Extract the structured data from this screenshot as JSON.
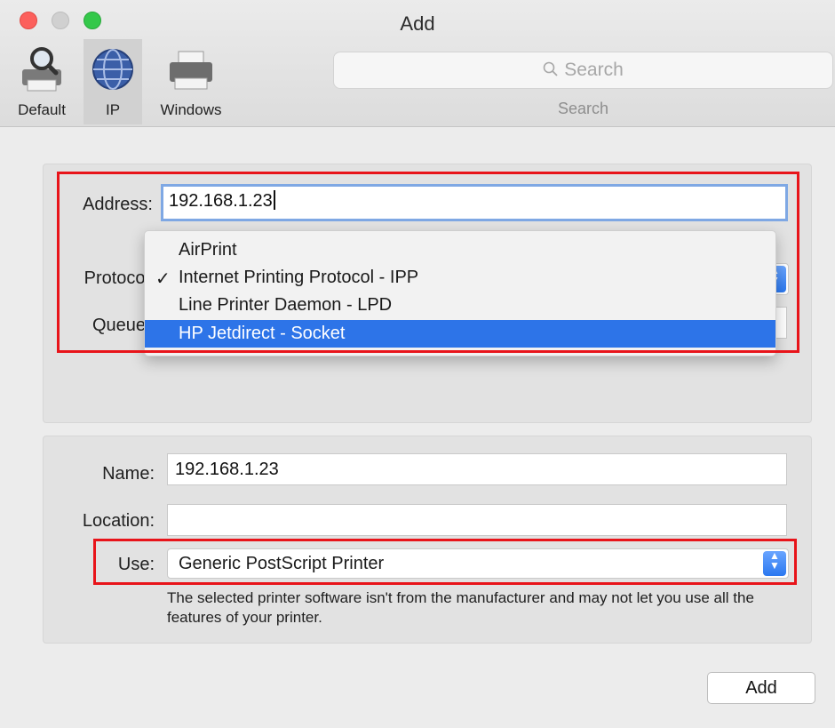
{
  "window": {
    "title": "Add"
  },
  "toolbar": {
    "tabs": [
      {
        "label": "Default",
        "icon": "magnifier-printer-icon"
      },
      {
        "label": "IP",
        "icon": "globe-icon",
        "active": true
      },
      {
        "label": "Windows",
        "icon": "printer-icon"
      }
    ],
    "search": {
      "placeholder": "Search",
      "caption": "Search"
    }
  },
  "form": {
    "address": {
      "label": "Address:",
      "value": "192.168.1.23"
    },
    "protocol": {
      "label": "Protocol"
    },
    "queue": {
      "label": "Queue"
    },
    "protocol_menu": {
      "items": [
        {
          "label": "AirPrint"
        },
        {
          "label": "Internet Printing Protocol - IPP",
          "checked": true,
          "check_glyph": "✓"
        },
        {
          "label": "Line Printer Daemon - LPD"
        },
        {
          "label": "HP Jetdirect - Socket",
          "highlighted": true
        }
      ]
    },
    "name": {
      "label": "Name:",
      "value": "192.168.1.23"
    },
    "location": {
      "label": "Location:",
      "value": ""
    },
    "use": {
      "label": "Use:",
      "value": "Generic PostScript Printer"
    },
    "note": "The selected printer software isn't from the manufacturer and may not let you use all the features of your printer."
  },
  "buttons": {
    "add": "Add"
  },
  "colors": {
    "highlight_border": "#e8141a",
    "menu_selection": "#2d74e8",
    "focus_ring": "#7fa8e4"
  }
}
